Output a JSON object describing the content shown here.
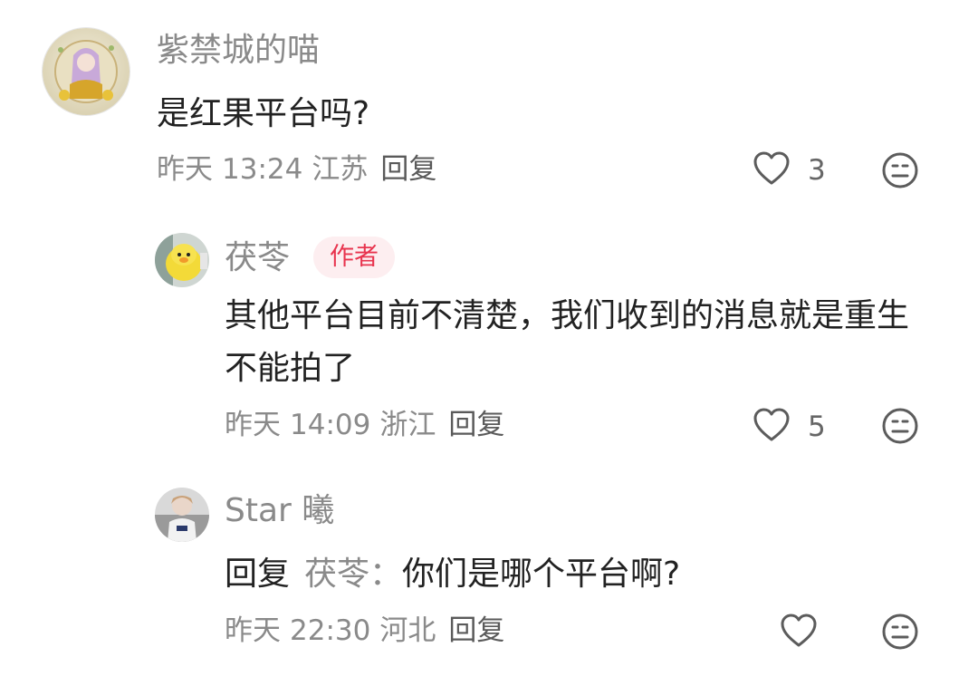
{
  "comments": [
    {
      "username": "紫禁城的喵",
      "content": "是红果平台吗?",
      "date": "昨天",
      "time": "13:24",
      "location": "江苏",
      "reply_label": "回复",
      "likes": "3",
      "like_icon": "heart-outline-icon",
      "dislike_icon": "meh-face-icon"
    },
    {
      "username": "茯苓",
      "badge": "作者",
      "content": "其他平台目前不清楚，我们收到的消息就是重生不能拍了",
      "date": "昨天",
      "time": "14:09",
      "location": "浙江",
      "reply_label": "回复",
      "likes": "5",
      "like_icon": "heart-outline-icon",
      "dislike_icon": "meh-face-icon"
    },
    {
      "username": "Star 曦",
      "reply_prefix": "回复",
      "reply_target": "茯苓：",
      "content": "你们是哪个平台啊?",
      "date": "昨天",
      "time": "22:30",
      "location": "河北",
      "reply_label": "回复",
      "likes": "",
      "like_icon": "heart-outline-icon",
      "dislike_icon": "meh-face-icon"
    }
  ],
  "colors": {
    "username": "#8a8a8a",
    "content": "#222222",
    "badge_text": "#e8344e",
    "badge_bg": "#fdeef0",
    "icon": "#666666"
  }
}
